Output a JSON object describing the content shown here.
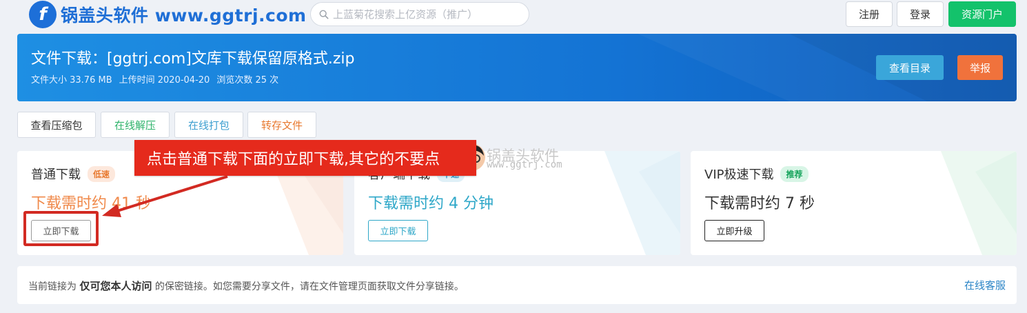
{
  "header": {
    "logo_letter": "f",
    "logo_text": "锅盖头软件 www.ggtrj.com",
    "search_placeholder": "上蓝菊花搜索上亿资源（推广）",
    "register_label": "注册",
    "login_label": "登录",
    "portal_label": "资源门户"
  },
  "banner": {
    "title": "文件下载：[ggtrj.com]文库下载保留原格式.zip",
    "size": "文件大小 33.76 MB",
    "upload_time": "上传时间 2020-04-20",
    "views": "浏览次数 25 次",
    "catalog_label": "查看目录",
    "report_label": "举报"
  },
  "tools": [
    "查看压缩包",
    "在线解压",
    "在线打包",
    "转存文件"
  ],
  "cards": [
    {
      "title": "普通下载",
      "badge": "低速",
      "time": "下载需时约 41 秒",
      "button": "立即下载"
    },
    {
      "title": "客户端下载",
      "badge": "中速",
      "time": "下载需时约 4 分钟",
      "button": "立即下载"
    },
    {
      "title": "VIP极速下载",
      "badge": "推荐",
      "time": "下载需时约 7 秒",
      "button": "立即升级"
    }
  ],
  "annotation": {
    "text": "点击普通下载下面的立即下载,其它的不要点"
  },
  "watermark": {
    "name": "锅盖头软件",
    "url": "www.ggtrj.com"
  },
  "notice": {
    "prefix": "当前链接为",
    "emphasis": "仅可您本人访问",
    "suffix": "的保密链接。如您需要分享文件，请在文件管理页面获取文件分享链接。",
    "link": "在线客服"
  },
  "colors": {
    "brand": "#1f6fd6",
    "portal": "#13c26b",
    "report": "#f0723c",
    "annotation": "#e52a1c"
  }
}
